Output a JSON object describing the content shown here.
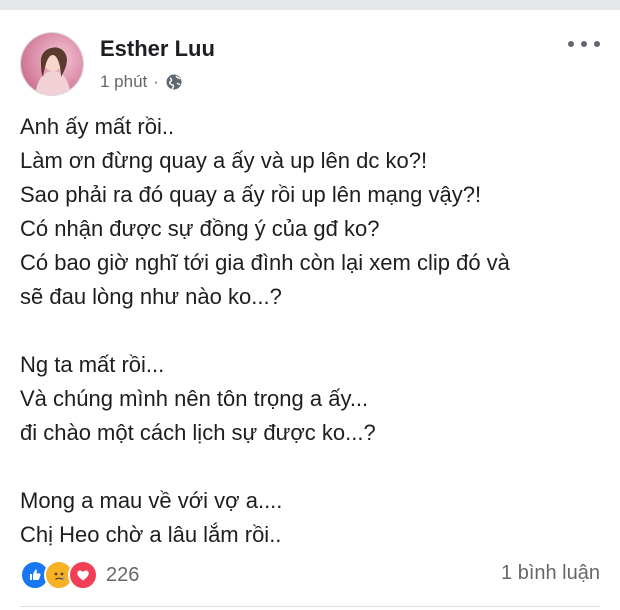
{
  "post": {
    "author": "Esther Luu",
    "time": "1 phút",
    "separator": "·",
    "privacy_icon": "globe-icon",
    "lines": [
      "Anh ấy mất rồi..",
      "Làm ơn đừng quay a ấy và up lên dc ko?!",
      "Sao phải ra đó quay a ấy rồi up lên mạng vậy?!",
      "Có nhận được sự đồng ý của gđ ko?",
      "Có bao giờ nghĩ tới gia đình còn lại xem clip đó và",
      "sẽ đau lòng như nào ko...?",
      "",
      "Ng ta mất rồi...",
      "Và chúng mình nên tôn trọng a ấy...",
      "đi chào một cách lịch sự được ko...?",
      "",
      "Mong a mau về với vợ a....",
      "Chị Heo chờ a lâu lắm rồi.."
    ],
    "reaction_icons": [
      "like-icon",
      "sad-icon",
      "love-icon"
    ],
    "reaction_count": "226",
    "comments": "1 bình luận"
  },
  "colors": {
    "like": "#1877f2",
    "sad": "#f7b125",
    "love": "#f33e58",
    "meta_text": "#65676b"
  }
}
